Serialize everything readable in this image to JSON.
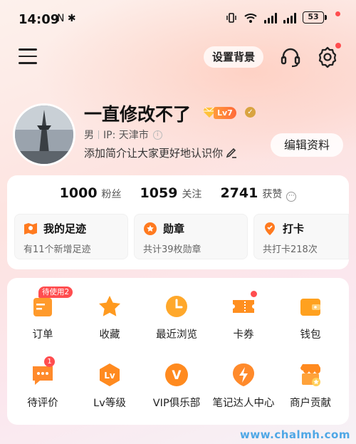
{
  "status_bar": {
    "time": "14:09",
    "left_icons": "N ✱",
    "battery": "53"
  },
  "top_bar": {
    "set_background_label": "设置背景",
    "customer_service_icon": "headset-icon",
    "settings_icon": "gear-icon"
  },
  "profile": {
    "nickname": "一直修改不了",
    "level": "Lv7",
    "verified_mark": "✓",
    "gender": "男",
    "ip_location": "IP: 天津市",
    "info_mark": "i",
    "bio": "添加简介让大家更好地认识你",
    "edit_label": "编辑资料"
  },
  "stats": [
    {
      "count": "1000",
      "label": "粉丝"
    },
    {
      "count": "1059",
      "label": "关注"
    },
    {
      "count": "2741",
      "label": "获赞"
    }
  ],
  "stats_more_mark": "···",
  "quick_cards": [
    {
      "title": "我的足迹",
      "subtitle": "有11个新增足迹",
      "icon": "map-pin-icon"
    },
    {
      "title": "勋章",
      "subtitle": "共计39枚勋章",
      "icon": "medal-icon"
    },
    {
      "title": "打卡",
      "subtitle": "共打卡218次",
      "icon": "location-icon"
    }
  ],
  "functions": [
    {
      "label": "订单",
      "icon": "order-icon",
      "badge": "待使用2"
    },
    {
      "label": "收藏",
      "icon": "star-icon"
    },
    {
      "label": "最近浏览",
      "icon": "clock-icon"
    },
    {
      "label": "卡券",
      "icon": "coupon-icon",
      "dot": true
    },
    {
      "label": "钱包",
      "icon": "wallet-icon"
    },
    {
      "label": "待评价",
      "icon": "comment-icon",
      "count": "1"
    },
    {
      "label": "Lv等级",
      "icon": "level-icon",
      "glyph": "Lv"
    },
    {
      "label": "VIP俱乐部",
      "icon": "vip-icon",
      "glyph": "V"
    },
    {
      "label": "笔记达人中心",
      "icon": "lightning-icon"
    },
    {
      "label": "商户贡献",
      "icon": "shop-icon"
    }
  ],
  "watermark": "www.chalmh.com",
  "colors": {
    "accent_orange": "#ff7a1f",
    "badge_red": "#ff4d4f",
    "watermark_blue": "#4fa7e6"
  }
}
